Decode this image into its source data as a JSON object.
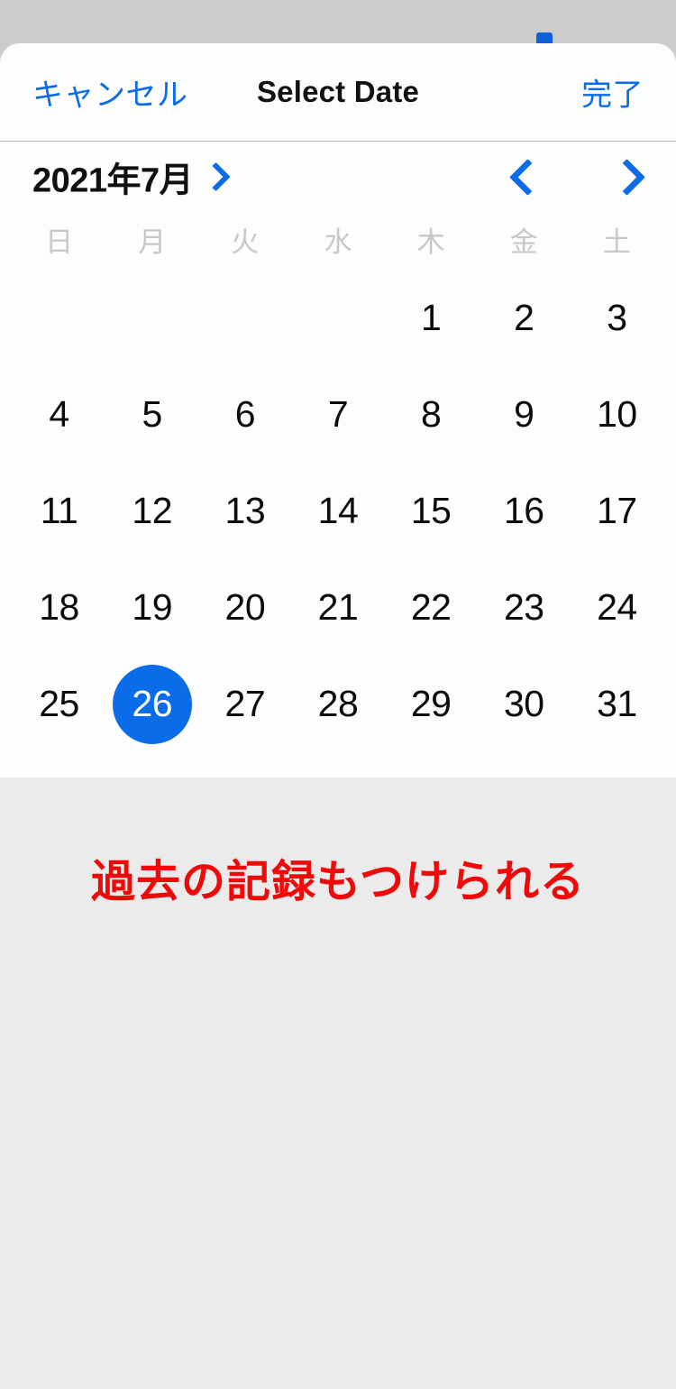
{
  "sheet": {
    "header": {
      "cancel_label": "キャンセル",
      "title": "Select Date",
      "done_label": "完了"
    },
    "month_bar": {
      "month_label": "2021年7月",
      "expand_icon": "chevron-right-icon",
      "prev_icon": "chevron-left-icon",
      "next_icon": "chevron-right-icon"
    },
    "calendar": {
      "weekdays": [
        "日",
        "月",
        "火",
        "水",
        "木",
        "金",
        "土"
      ],
      "leading_blanks": 4,
      "days": [
        "1",
        "2",
        "3",
        "4",
        "5",
        "6",
        "7",
        "8",
        "9",
        "10",
        "11",
        "12",
        "13",
        "14",
        "15",
        "16",
        "17",
        "18",
        "19",
        "20",
        "21",
        "22",
        "23",
        "24",
        "25",
        "26",
        "27",
        "28",
        "29",
        "30",
        "31"
      ],
      "selected_day": "26"
    }
  },
  "annotation": {
    "text": "過去の記録もつけられる"
  },
  "colors": {
    "accent_blue": "#0a6ce8",
    "annotation_red": "#ef0a0a",
    "backdrop_gray": "#cccccc",
    "page_gray": "#ebebeb",
    "weekday_gray": "#c7c7cc"
  }
}
